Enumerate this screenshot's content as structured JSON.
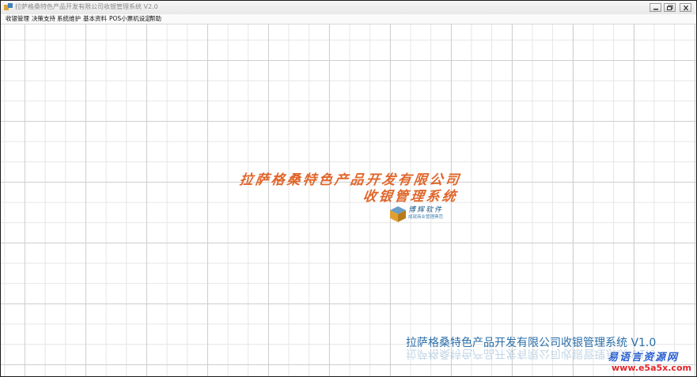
{
  "window": {
    "title": "拉萨格桑特色产品开发有限公司收银管理系统 V2.0"
  },
  "menu": {
    "items": [
      "收银管理",
      "决策支持",
      "系统维护",
      "基本资料",
      "POS小票机设定",
      "帮助"
    ]
  },
  "splash": {
    "company_name": "拉萨格桑特色产品开发有限公司",
    "system_name": "收银管理系统"
  },
  "logo": {
    "name": "博辉软件",
    "tagline": "成就商业管理典范"
  },
  "footer": {
    "title": "拉萨格桑特色产品开发有限公司收银管理系统 V1.0"
  },
  "watermark": {
    "name": "易语言资源网",
    "url": "www.e5a5x.com"
  },
  "colors": {
    "accent_orange": "#e0662a",
    "footer_blue": "#2a6ea8",
    "watermark_blue": "#2a5ecf",
    "watermark_red": "#e0262a"
  },
  "icons": [
    "app-icon",
    "minimize-icon",
    "restore-icon",
    "close-icon",
    "logo-cube-icon"
  ]
}
